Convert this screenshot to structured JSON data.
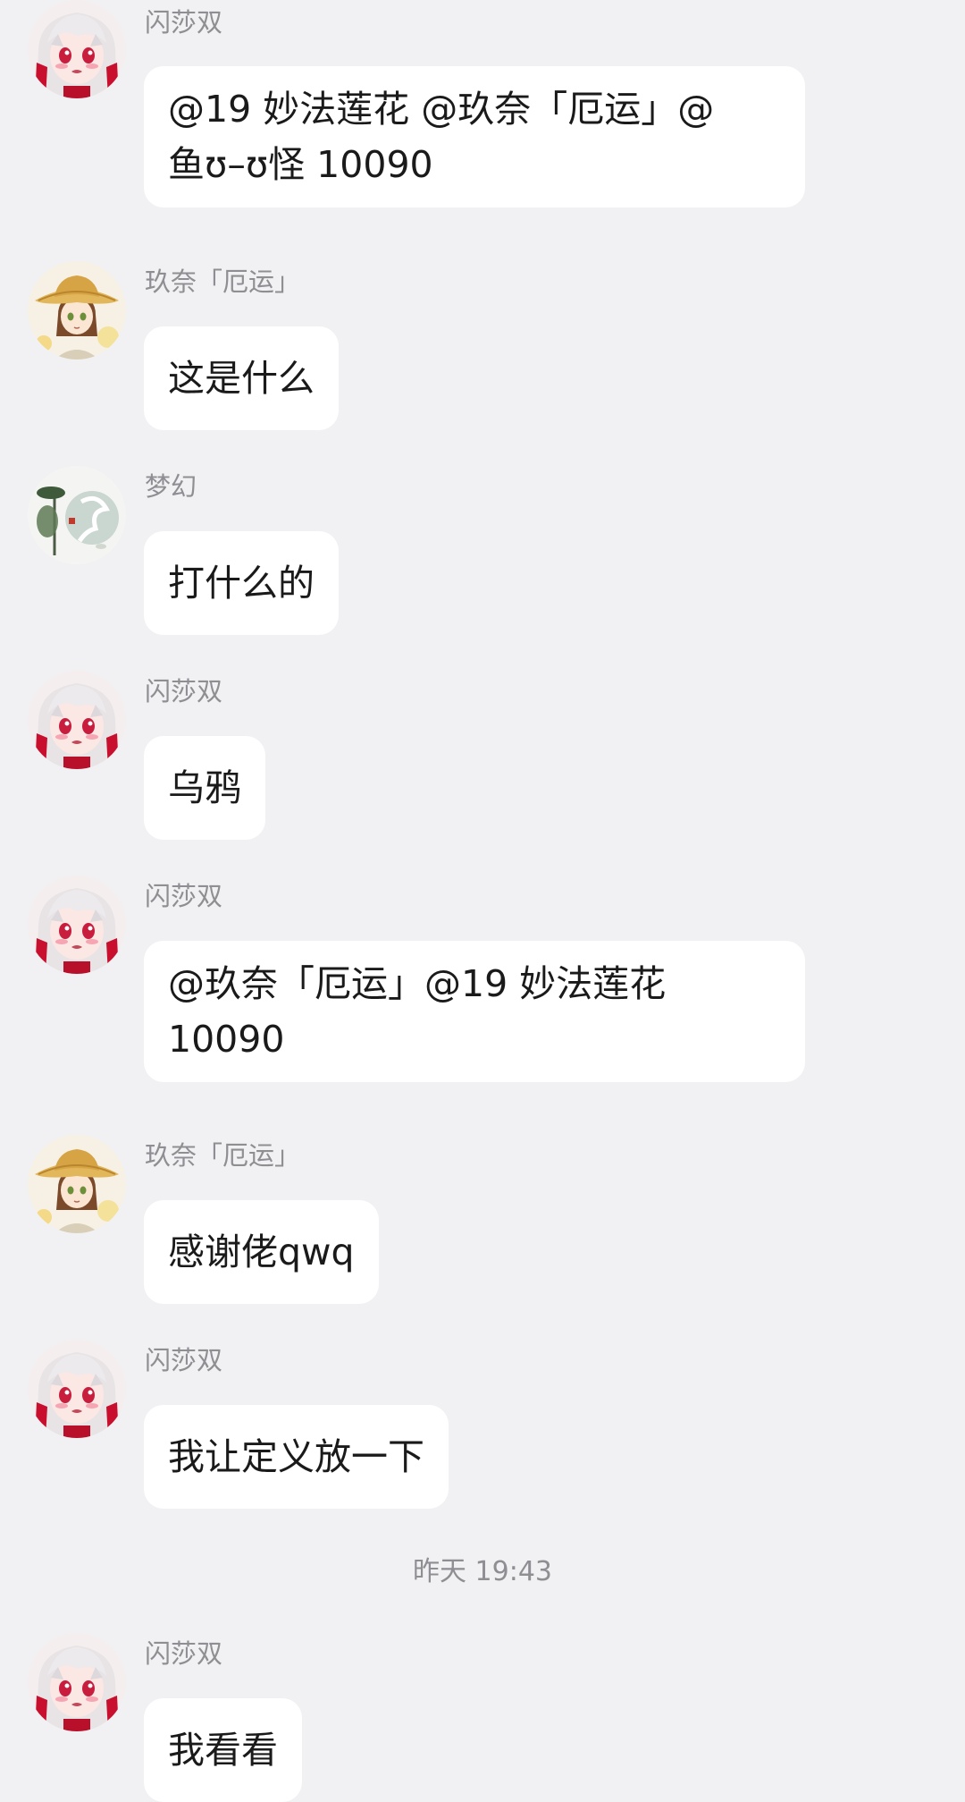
{
  "colors": {
    "background": "#f1f1f3",
    "bubble": "#ffffff",
    "sender_name": "#8e8e93",
    "message_text": "#1a1a1a"
  },
  "messages": [
    {
      "sender": "闪莎双",
      "avatar": "anime-girl-red-white-hair",
      "line1": "@19  妙法莲花 @玖奈「厄运」@",
      "line2": "鱼ʊ–ʊ怪 10090"
    },
    {
      "sender": "玖奈「厄运」",
      "avatar": "girl-straw-hat",
      "text": "这是什么"
    },
    {
      "sender": "梦幻",
      "avatar": "ink-lotus-painting",
      "text": "打什么的"
    },
    {
      "sender": "闪莎双",
      "avatar": "anime-girl-red-white-hair",
      "text": "乌鸦"
    },
    {
      "sender": "闪莎双",
      "avatar": "anime-girl-red-white-hair",
      "line1": "@玖奈「厄运」@19  妙法莲花",
      "line2": "10090"
    },
    {
      "sender": "玖奈「厄运」",
      "avatar": "girl-straw-hat",
      "text": "感谢佬qwq"
    },
    {
      "sender": "闪莎双",
      "avatar": "anime-girl-red-white-hair",
      "text": "我让定义放一下"
    },
    {
      "sender": "闪莎双",
      "avatar": "anime-girl-red-white-hair",
      "text": "我看看"
    }
  ],
  "time_divider": "昨天 19:43"
}
